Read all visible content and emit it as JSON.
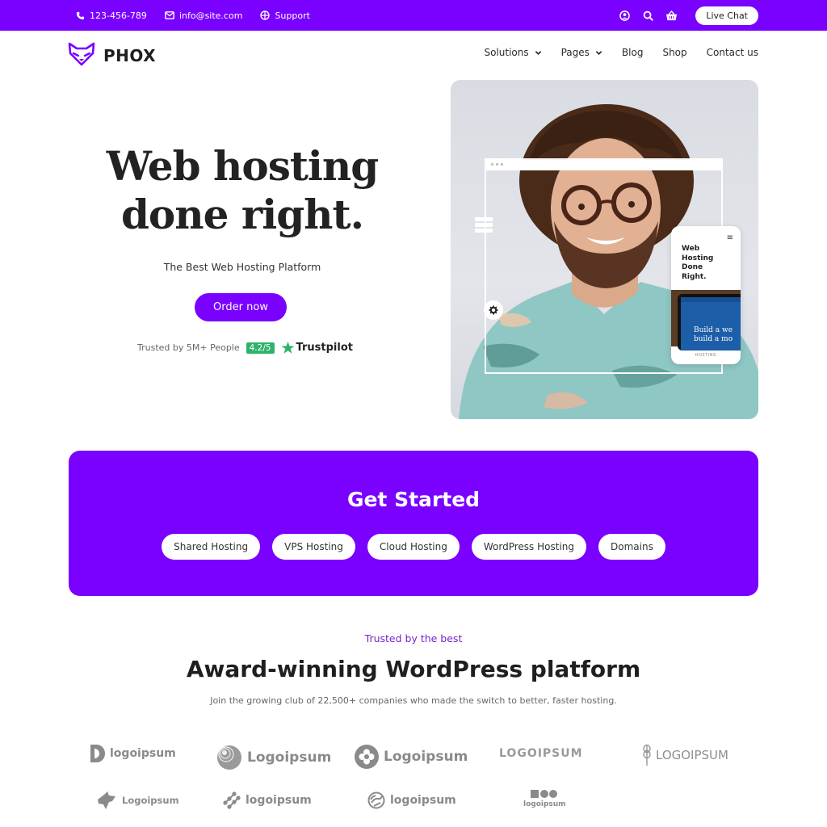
{
  "colors": {
    "brand": "#7a00ff",
    "rating_green": "#2fb36a",
    "eyebrow": "#7a22cc"
  },
  "topbar": {
    "phone": {
      "icon": "phone-icon",
      "label": "123-456-789"
    },
    "email": {
      "icon": "envelope-icon",
      "label": "info@site.com"
    },
    "support": {
      "icon": "globe-icon",
      "label": "Support"
    },
    "icons": [
      "user-icon",
      "search-icon",
      "basket-icon"
    ],
    "live_chat": "Live Chat"
  },
  "brand": {
    "name": "PHOX",
    "icon": "fox-logo-icon"
  },
  "nav": {
    "items": [
      {
        "label": "Solutions",
        "dropdown": true
      },
      {
        "label": "Pages",
        "dropdown": true
      },
      {
        "label": "Blog",
        "dropdown": false
      },
      {
        "label": "Shop",
        "dropdown": false
      },
      {
        "label": "Contact us",
        "dropdown": false
      }
    ]
  },
  "hero": {
    "title_line1": "Web hosting",
    "title_line2": "done right.",
    "subtitle": "The Best Web Hosting Platform",
    "cta": "Order now",
    "trusted_text": "Trusted by 5M+ People",
    "rating": "4.2/5",
    "trustpilot": "Trustpilot",
    "phone_mock": {
      "heading": [
        "Web",
        "Hosting",
        "Done",
        "Right."
      ],
      "screen_text": [
        "Build a we",
        "build a mo"
      ],
      "footer": "HOSTING"
    }
  },
  "get_started": {
    "title": "Get Started",
    "pills": [
      "Shared Hosting",
      "VPS Hosting",
      "Cloud Hosting",
      "WordPress Hosting",
      "Domains"
    ]
  },
  "trusted": {
    "eyebrow": "Trusted by the best",
    "title": "Award-winning WordPress platform",
    "subtitle": "Join the growing club of 22,500+ companies who made the switch to better, faster hosting."
  },
  "logos": [
    {
      "label": "logoipsum",
      "icon": "half-circle-logo-icon"
    },
    {
      "label": "Logoipsum",
      "icon": "sphere-logo-icon"
    },
    {
      "label": "Logoipsum",
      "icon": "clover-logo-icon"
    },
    {
      "label": "LOGOIPSUM",
      "icon": "wordmark-logo"
    },
    {
      "label": "LOGOIPSUM",
      "icon": "wheat-logo-icon"
    },
    {
      "label": "Logoipsum",
      "icon": "animal-logo-icon"
    },
    {
      "label": "logoipsum",
      "icon": "dots-network-logo-icon"
    },
    {
      "label": "logoipsum",
      "icon": "striped-circle-logo-icon"
    },
    {
      "label": "logoipsum",
      "icon": "shapes-logo-icon"
    }
  ]
}
